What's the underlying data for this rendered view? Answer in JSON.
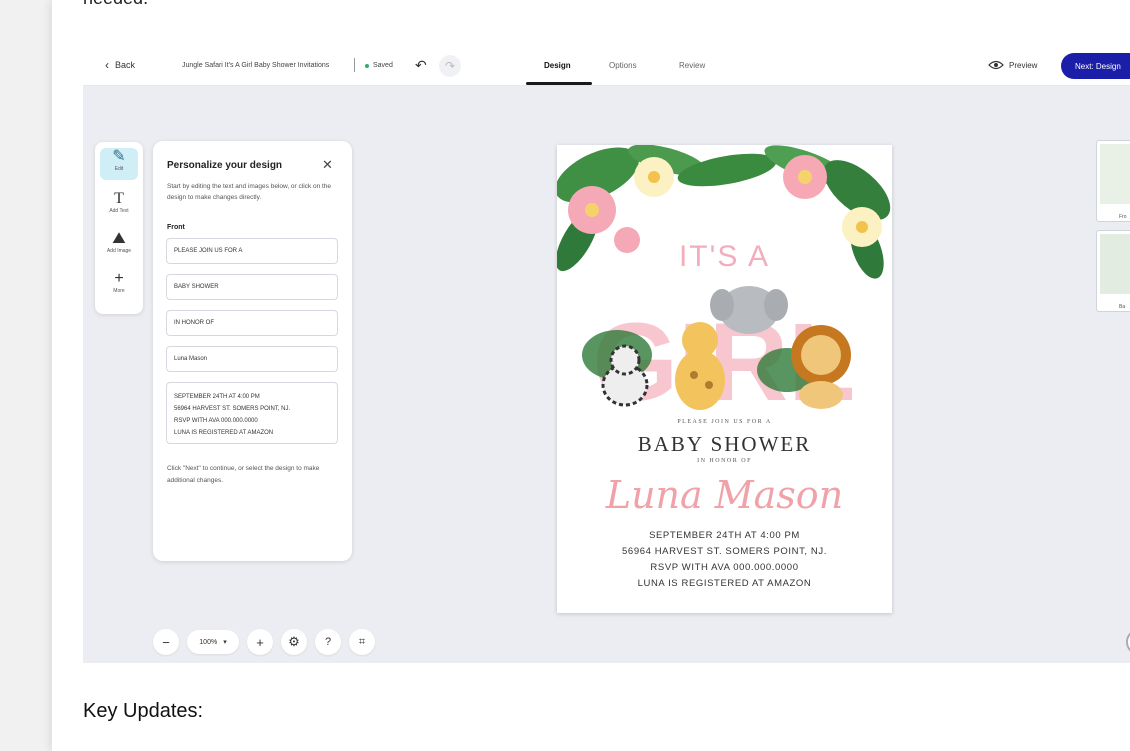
{
  "doc": {
    "cut_text": "needed.",
    "key_heading": "Key Updates:"
  },
  "topbar": {
    "back_label": "Back",
    "title": "Jungle Safari It's A Girl Baby Shower Invitations",
    "saved": "Saved",
    "tabs": [
      "Design",
      "Options",
      "Review"
    ],
    "active_tab": "Design",
    "preview_label": "Preview",
    "next_label": "Next: Design"
  },
  "toolbar": {
    "items": [
      {
        "label": "Edit",
        "icon": "magic-wand-icon"
      },
      {
        "label": "Add Text",
        "icon": "text-icon"
      },
      {
        "label": "Add Image",
        "icon": "image-add-icon"
      },
      {
        "label": "More",
        "icon": "plus-icon"
      }
    ]
  },
  "panel": {
    "title": "Personalize your design",
    "description": "Start by editing the text and images below, or click on the design to make changes directly.",
    "section": "Front",
    "fields": [
      "PLEASE JOIN US FOR A",
      "BABY SHOWER",
      "IN HONOR OF",
      "Luna Mason"
    ],
    "details_lines": [
      "SEPTEMBER 24TH AT 4:00 PM",
      "56964 HARVEST ST. SOMERS POINT, NJ.",
      "RSVP WITH AVA 000.000.0000",
      "LUNA IS REGISTERED AT AMAZON"
    ],
    "footer": "Click \"Next\" to continue, or select the design to make additional changes."
  },
  "card": {
    "its": "IT'S A",
    "girl": "GIRL",
    "please": "PLEASE JOIN US FOR A",
    "baby": "BABY SHOWER",
    "honor": "IN HONOR OF",
    "name": "Luna Mason",
    "details": [
      "SEPTEMBER 24TH AT 4:00 PM",
      "56964 HARVEST ST. SOMERS POINT, NJ.",
      "RSVP WITH AVA 000.000.0000",
      "LUNA IS REGISTERED AT AMAZON"
    ]
  },
  "zoom": {
    "value": "100%"
  },
  "thumbs": {
    "front": "Fro",
    "back": "Ba"
  },
  "colors": {
    "accent": "#1b1ea8",
    "pink": "#f2aebd",
    "canvas": "#ebedf2"
  }
}
